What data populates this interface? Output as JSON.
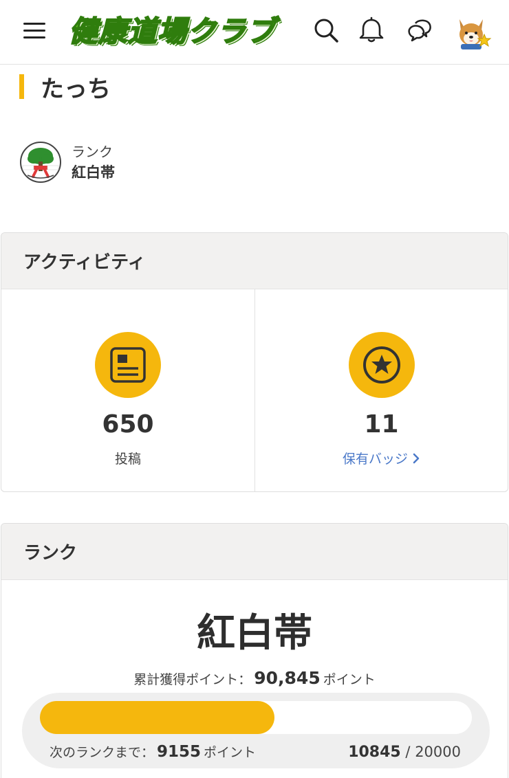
{
  "header": {
    "logo_text": "健康道場クラブ",
    "icons": [
      "menu-icon",
      "search-icon",
      "bell-icon",
      "chat-icon",
      "avatar"
    ]
  },
  "profile": {
    "name": "たっち",
    "rank_label": "ランク",
    "rank_value": "紅白帯"
  },
  "activity": {
    "title": "アクティビティ",
    "posts": {
      "count": "650",
      "label": "投稿"
    },
    "badges": {
      "count": "11",
      "link_label": "保有バッジ"
    }
  },
  "rank_section": {
    "title": "ランク",
    "rank_name": "紅白帯",
    "total_points_label": "累計獲得ポイント：",
    "total_points_value": "90,845",
    "points_unit": "ポイント",
    "next_rank_label": "次のランクまで：",
    "next_rank_value": "9155",
    "progress_current": "10845",
    "progress_separator": "/",
    "progress_max": "20000",
    "progress_fraction": 0.5423
  },
  "colors": {
    "accent": "#f5b70d",
    "link": "#4a78c8",
    "logo_green": "#62c41a"
  }
}
